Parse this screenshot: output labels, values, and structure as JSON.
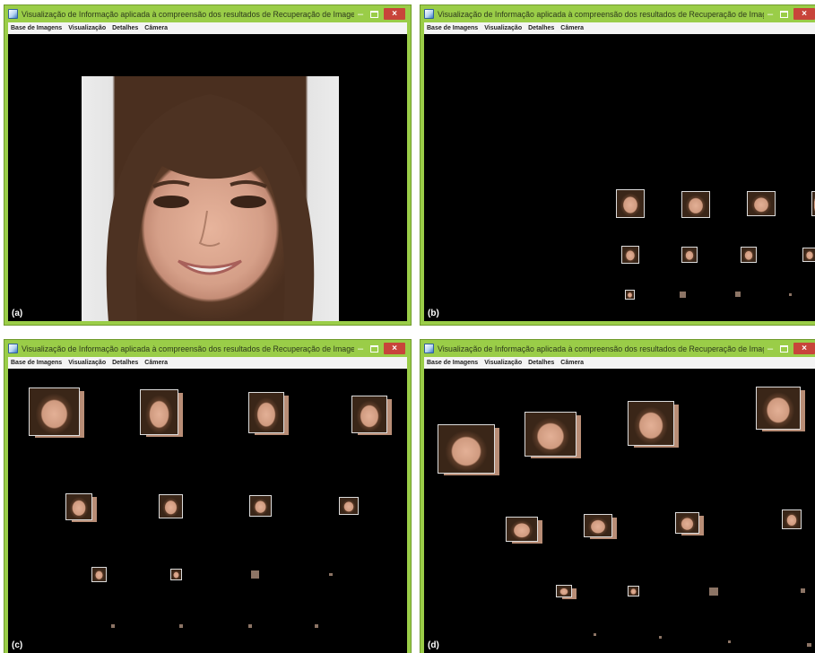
{
  "window_title": "Visualização de Informação aplicada à compreensão dos resultados de Recuperação de Imagens Baseada em Co...",
  "menu": [
    "Base de Imagens",
    "Visualização",
    "Detalhes",
    "Câmera"
  ],
  "window_controls": {
    "minimize": "–",
    "close": "×"
  },
  "panels": [
    {
      "label": "(a)",
      "view": "single-image"
    },
    {
      "label": "(b)",
      "view": "thumbnail-grid"
    },
    {
      "label": "(c)",
      "view": "cube-grid-front"
    },
    {
      "label": "(d)",
      "view": "cube-grid-perspective"
    }
  ],
  "colors": {
    "frame": "#9acd48",
    "canvas": "#000000",
    "close_button": "#c8443a",
    "menubar": "#f4f4f4"
  },
  "icons": {
    "window_icon": "app-icon",
    "photo": "face-photo-icon",
    "thumbnail": "face-thumbnail-icon"
  }
}
